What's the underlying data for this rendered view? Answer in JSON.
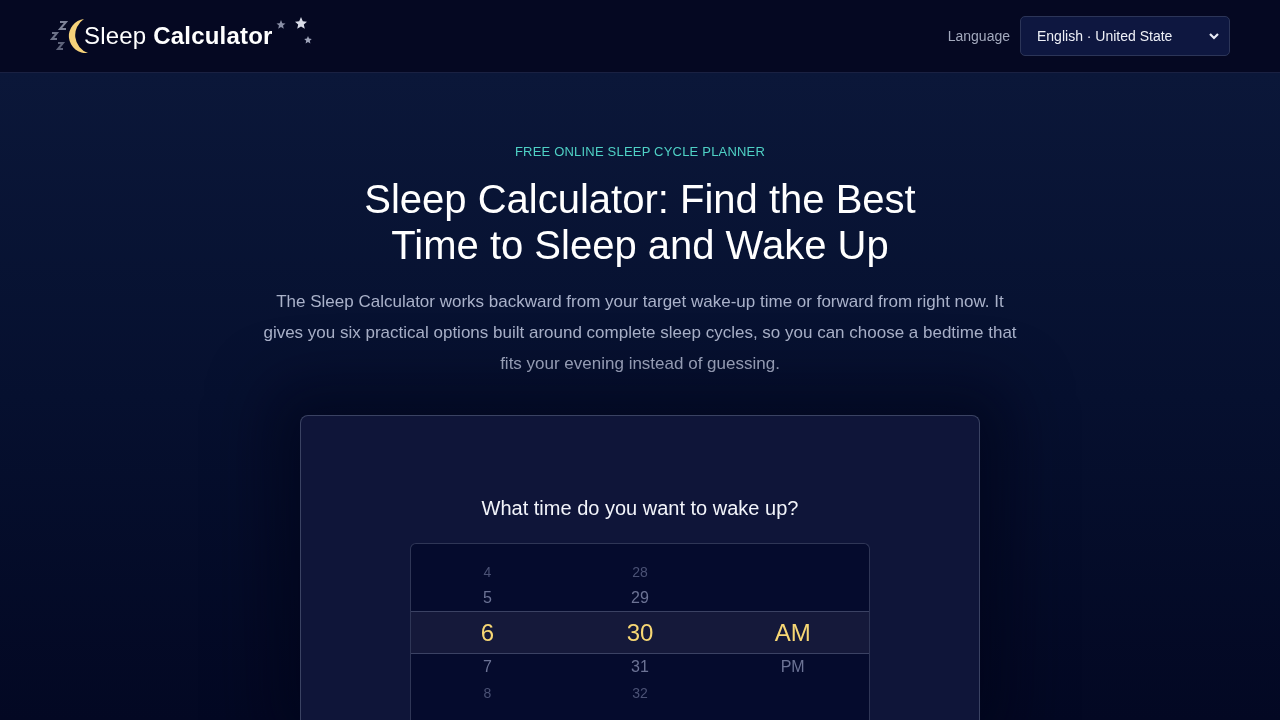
{
  "header": {
    "logo": "Sleep **Calculator**",
    "language_label": "Language",
    "language_select": {
      "value": "English · United State"
    }
  },
  "hero": {
    "eyebrow": "FREE ONLINE SLEEP CYCLE PLANNER",
    "title": "Sleep Calculator: Find the Best Time to Sleep and Wake Up",
    "description": "The Sleep Calculator works backward from your target wake-up time or forward from right now. It gives you six practical options built around complete sleep cycles, so you can choose a bedtime that fits your evening instead of guessing."
  },
  "calculator": {
    "question": "What time do you want to wake up?",
    "time_picker": {
      "columns": [
        {
          "items": [
            {
              "label": "4",
              "selected": false
            },
            {
              "label": "5",
              "selected": false
            },
            {
              "label": "6",
              "selected": true
            },
            {
              "label": "7",
              "selected": false
            },
            {
              "label": "8",
              "selected": false
            }
          ]
        },
        {
          "items": [
            {
              "label": "28",
              "selected": false
            },
            {
              "label": "29",
              "selected": false
            },
            {
              "label": "30",
              "selected": true
            },
            {
              "label": "31",
              "selected": false
            },
            {
              "label": "32",
              "selected": false
            }
          ]
        },
        {
          "items": [
            {
              "label": "AM",
              "selected": true
            },
            {
              "label": "PM",
              "selected": false
            }
          ]
        }
      ]
    }
  }
}
